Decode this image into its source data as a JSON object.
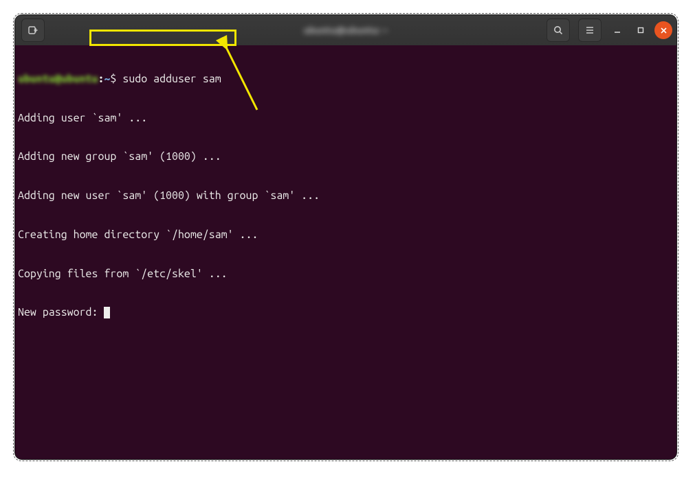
{
  "window": {
    "title_blurred": "ubuntu@ubuntu: ~"
  },
  "terminal": {
    "prompt_user_blurred": "ubuntu@ubuntu",
    "prompt_sep": ":",
    "prompt_path": "~",
    "prompt_symbol": "$",
    "command": "sudo adduser sam",
    "lines": [
      "Adding user `sam' ...",
      "Adding new group `sam' (1000) ...",
      "Adding new user `sam' (1000) with group `sam' ...",
      "Creating home directory `/home/sam' ...",
      "Copying files from `/etc/skel' ...",
      "New password: "
    ]
  },
  "annotation": {
    "highlight_color": "#f2e600"
  }
}
